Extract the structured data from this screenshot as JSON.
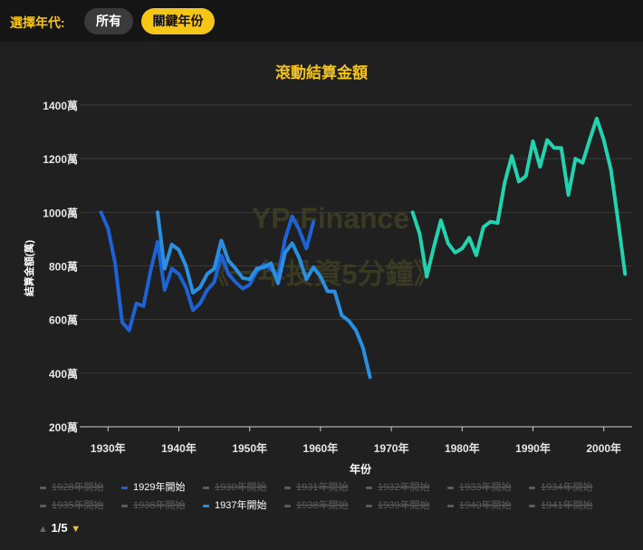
{
  "filter": {
    "label": "選擇年代:",
    "buttons": [
      {
        "label": "所有",
        "active": false
      },
      {
        "label": "關鍵年份",
        "active": true
      }
    ]
  },
  "colors": {
    "accent": "#f5c518",
    "series_1929": "#1e63d6",
    "series_1937": "#2a8fe0",
    "series_1973": "#22d3b0",
    "grid": "#3a3a3a",
    "axis_text": "#e6e6e6"
  },
  "watermark": {
    "line1": "YP-Finance",
    "line2": "《一年投資5分鐘》"
  },
  "pager": {
    "current": "1/5",
    "up_icon": "triangle-up-icon",
    "down_icon": "triangle-down-icon"
  },
  "chart_data": {
    "type": "line",
    "title": "滾動結算金額",
    "xlabel": "年份",
    "ylabel": "結算金額(萬)",
    "xlim": [
      1926,
      2004
    ],
    "ylim": [
      200,
      1400
    ],
    "y_ticks": [
      200,
      400,
      600,
      800,
      1000,
      1200,
      1400
    ],
    "y_tick_labels": [
      "200萬",
      "400萬",
      "600萬",
      "800萬",
      "1000萬",
      "1200萬",
      "1400萬"
    ],
    "x_ticks": [
      1930,
      1940,
      1950,
      1960,
      1970,
      1980,
      1990,
      2000
    ],
    "x_tick_labels": [
      "1930年",
      "1940年",
      "1950年",
      "1960年",
      "1970年",
      "1980年",
      "1990年",
      "2000年"
    ],
    "grid": true,
    "legend_position": "bottom",
    "legend": [
      {
        "label": "1928年開始",
        "visible": false
      },
      {
        "label": "1929年開始",
        "visible": true
      },
      {
        "label": "1930年開始",
        "visible": false
      },
      {
        "label": "1931年開始",
        "visible": false
      },
      {
        "label": "1932年開始",
        "visible": false
      },
      {
        "label": "1933年開始",
        "visible": false
      },
      {
        "label": "1934年開始",
        "visible": false
      },
      {
        "label": "1935年開始",
        "visible": false
      },
      {
        "label": "1936年開始",
        "visible": false
      },
      {
        "label": "1937年開始",
        "visible": true
      },
      {
        "label": "1938年開始",
        "visible": false
      },
      {
        "label": "1939年開始",
        "visible": false
      },
      {
        "label": "1940年開始",
        "visible": false
      },
      {
        "label": "1941年開始",
        "visible": false
      }
    ],
    "series": [
      {
        "name": "1929年開始",
        "color": "#1e63d6",
        "x": [
          1929,
          1930,
          1931,
          1932,
          1933,
          1934,
          1935,
          1936,
          1937,
          1938,
          1939,
          1940,
          1941,
          1942,
          1943,
          1944,
          1945,
          1946,
          1947,
          1948,
          1949,
          1950,
          1951,
          1952,
          1953,
          1954,
          1955,
          1956,
          1957,
          1958,
          1959
        ],
        "y": [
          1000,
          940,
          810,
          590,
          560,
          660,
          650,
          780,
          890,
          710,
          790,
          770,
          720,
          635,
          660,
          710,
          740,
          840,
          770,
          740,
          715,
          730,
          780,
          805,
          790,
          760,
          900,
          985,
          935,
          865,
          965
        ]
      },
      {
        "name": "1937年開始",
        "color": "#2a8fe0",
        "x": [
          1937,
          1938,
          1939,
          1940,
          1941,
          1942,
          1943,
          1944,
          1945,
          1946,
          1947,
          1948,
          1949,
          1950,
          1951,
          1952,
          1953,
          1954,
          1955,
          1956,
          1957,
          1958,
          1959,
          1960,
          1961,
          1962,
          1963,
          1964,
          1965,
          1966,
          1967
        ],
        "y": [
          1000,
          790,
          880,
          860,
          800,
          700,
          720,
          770,
          790,
          895,
          820,
          790,
          755,
          750,
          790,
          795,
          810,
          735,
          850,
          885,
          830,
          750,
          795,
          760,
          705,
          705,
          615,
          595,
          560,
          495,
          385
        ]
      },
      {
        "name": "",
        "color": "#22d3b0",
        "x": [
          1973,
          1974,
          1975,
          1976,
          1977,
          1978,
          1979,
          1980,
          1981,
          1982,
          1983,
          1984,
          1985,
          1986,
          1987,
          1988,
          1989,
          1990,
          1991,
          1992,
          1993,
          1994,
          1995,
          1996,
          1997,
          1998,
          1999,
          2000,
          2001,
          2002,
          2003
        ],
        "y": [
          1000,
          920,
          760,
          870,
          970,
          885,
          850,
          865,
          905,
          840,
          945,
          965,
          960,
          1110,
          1210,
          1115,
          1135,
          1265,
          1170,
          1270,
          1240,
          1240,
          1065,
          1200,
          1185,
          1270,
          1350,
          1270,
          1160,
          970,
          770
        ]
      }
    ]
  }
}
